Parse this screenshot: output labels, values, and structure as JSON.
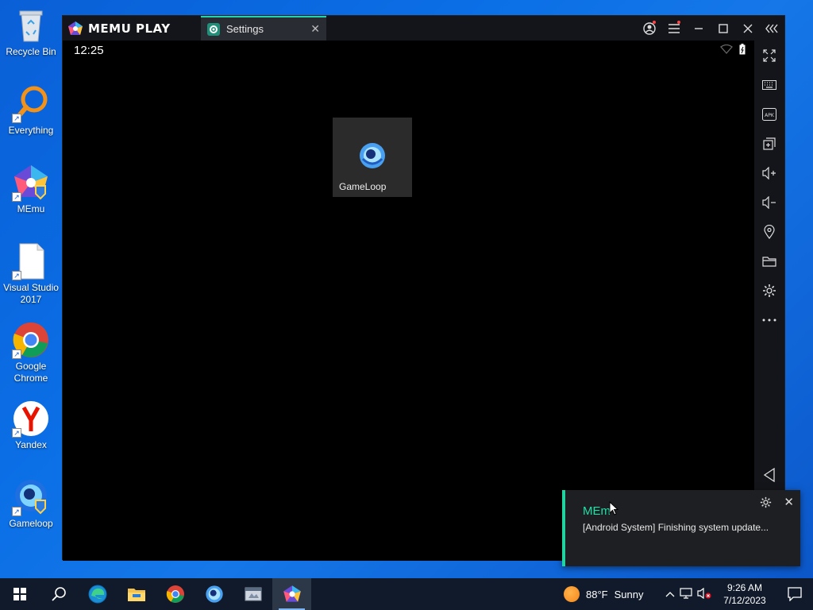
{
  "desktop": {
    "icons": [
      {
        "label": "Recycle Bin",
        "icon": "recycle-bin-icon"
      },
      {
        "label": "Everything",
        "icon": "everything-search-icon"
      },
      {
        "label": "MEmu",
        "icon": "memu-icon"
      },
      {
        "label": "Visual Studio 2017",
        "icon": "file-icon"
      },
      {
        "label": "Google Chrome",
        "icon": "chrome-icon"
      },
      {
        "label": "Yandex",
        "icon": "yandex-icon"
      },
      {
        "label": "Gameloop",
        "icon": "gameloop-icon"
      }
    ]
  },
  "emulator": {
    "brand": "MEMU PLAY",
    "tab_label": "Settings",
    "time": "12:25",
    "app_tile": {
      "label": "GameLoop",
      "icon": "gameloop-icon"
    },
    "sidebar_icons": [
      "fullscreen-icon",
      "keyboard-icon",
      "apk-icon",
      "multi-instance-icon",
      "volume-up-icon",
      "volume-down-icon",
      "location-icon",
      "folder-icon",
      "settings-icon",
      "more-icon",
      "back-icon"
    ]
  },
  "notification": {
    "title": "MEm",
    "message": "[Android System] Finishing system update..."
  },
  "taskbar": {
    "weather_temp": "88°F",
    "weather_text": "Sunny",
    "time": "9:26 AM",
    "date": "7/12/2023"
  },
  "colors": {
    "accent": "#20d3a0",
    "taskbar": "#101a2b"
  }
}
